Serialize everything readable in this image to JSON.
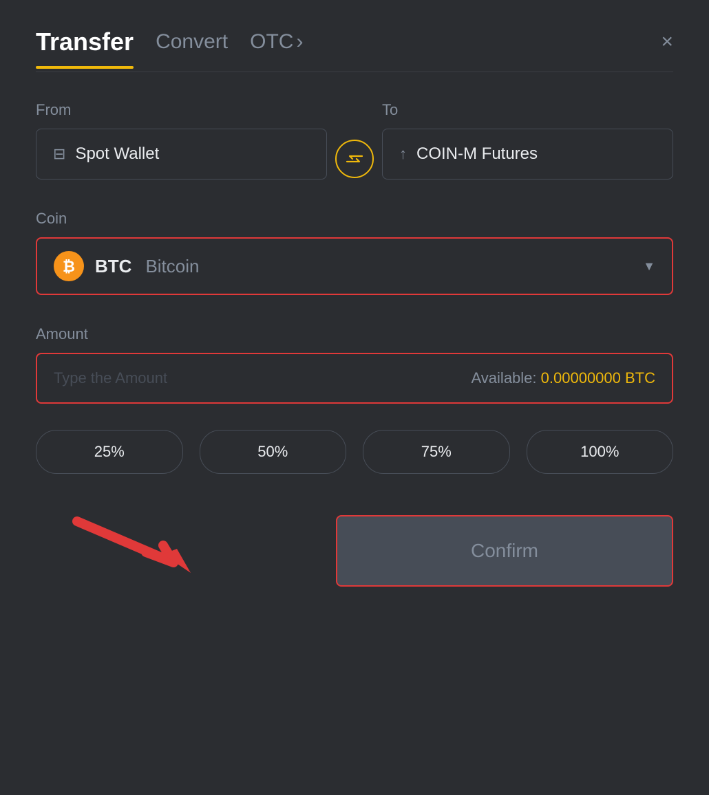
{
  "header": {
    "tab_transfer": "Transfer",
    "tab_convert": "Convert",
    "tab_otc": "OTC",
    "tab_otc_arrow": "›",
    "close": "×"
  },
  "from_label": "From",
  "to_label": "To",
  "from_wallet": "Spot Wallet",
  "to_wallet": "COIN-M Futures",
  "coin_label": "Coin",
  "coin_symbol": "BTC",
  "coin_name": "Bitcoin",
  "amount_label": "Amount",
  "amount_placeholder": "Type the Amount",
  "available_label": "Available:",
  "available_value": "0.00000000 BTC",
  "pct_buttons": [
    "25%",
    "50%",
    "75%",
    "100%"
  ],
  "confirm_label": "Confirm",
  "colors": {
    "accent": "#f0b90b",
    "error_border": "#e03939",
    "bg_dark": "#2b2d31",
    "text_muted": "#848e9c",
    "text_primary": "#eaecef"
  }
}
